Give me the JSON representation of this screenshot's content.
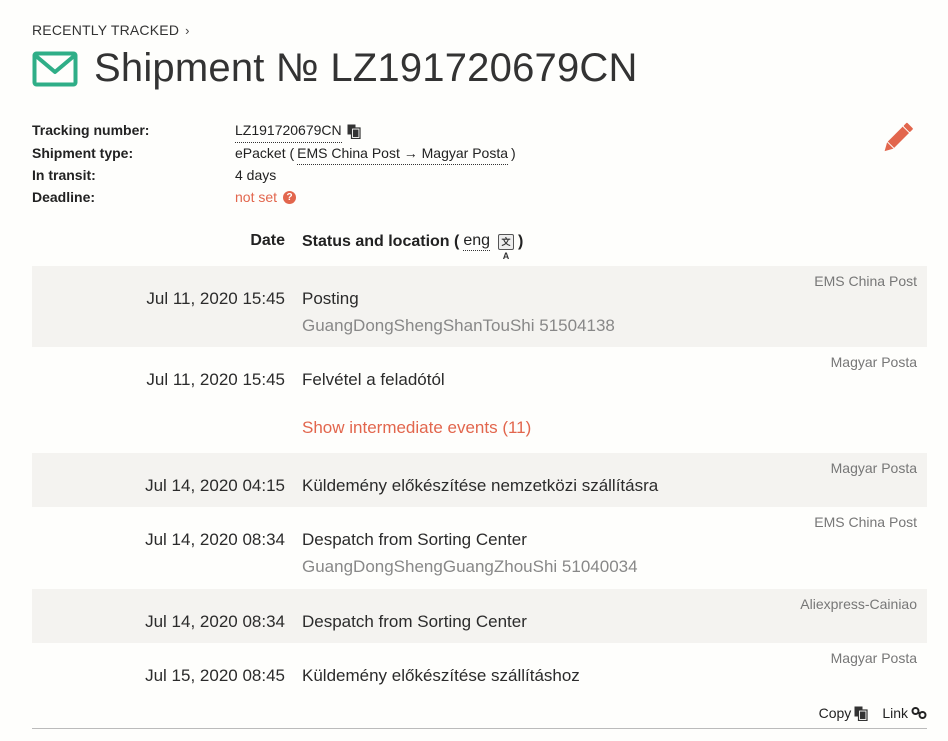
{
  "breadcrumb": {
    "label": "RECENTLY TRACKED",
    "chevron": "›"
  },
  "header": {
    "title": "Shipment № LZ191720679CN",
    "icon": "envelope-icon",
    "accent": "#2fae87"
  },
  "info": {
    "tracking_label": "Tracking number:",
    "tracking_value": "LZ191720679CN",
    "type_label": "Shipment type:",
    "type_prefix": "ePacket (",
    "type_route": "EMS China Post → Magyar Posta",
    "type_suffix": ")",
    "transit_label": "In transit:",
    "transit_value": "4 days",
    "deadline_label": "Deadline:",
    "deadline_value": "not set",
    "deadline_help": "?"
  },
  "table": {
    "date_header": "Date",
    "status_header": "Status and location (",
    "lang": "eng",
    "lang_close": ")",
    "translate_glyph": "文A"
  },
  "events": [
    {
      "date": "Jul 11, 2020 15:45",
      "status": "Posting",
      "location": "GuangDongShengShanTouShi 51504138",
      "carrier": "EMS China Post"
    },
    {
      "date": "Jul 11, 2020 15:45",
      "status": "Felvétel a feladótól",
      "location": "",
      "carrier": "Magyar Posta",
      "more": "Show intermediate events (11)"
    },
    {
      "date": "Jul 14, 2020 04:15",
      "status": "Küldemény előkészítése nemzetközi szállításra",
      "location": "",
      "carrier": "Magyar Posta"
    },
    {
      "date": "Jul 14, 2020 08:34",
      "status": "Despatch from Sorting Center",
      "location": "GuangDongShengGuangZhouShi 51040034",
      "carrier": "EMS China Post"
    },
    {
      "date": "Jul 14, 2020 08:34",
      "status": "Despatch from Sorting Center",
      "location": "",
      "carrier": "Aliexpress-Cainiao"
    },
    {
      "date": "Jul 15, 2020 08:45",
      "status": "Küldemény előkészítése szállításhoz",
      "location": "",
      "carrier": "Magyar Posta"
    }
  ],
  "footer": {
    "copy_label": "Copy",
    "link_label": "Link"
  },
  "colors": {
    "accent_red": "#e2664d",
    "row_shade": "#f4f3f0"
  }
}
